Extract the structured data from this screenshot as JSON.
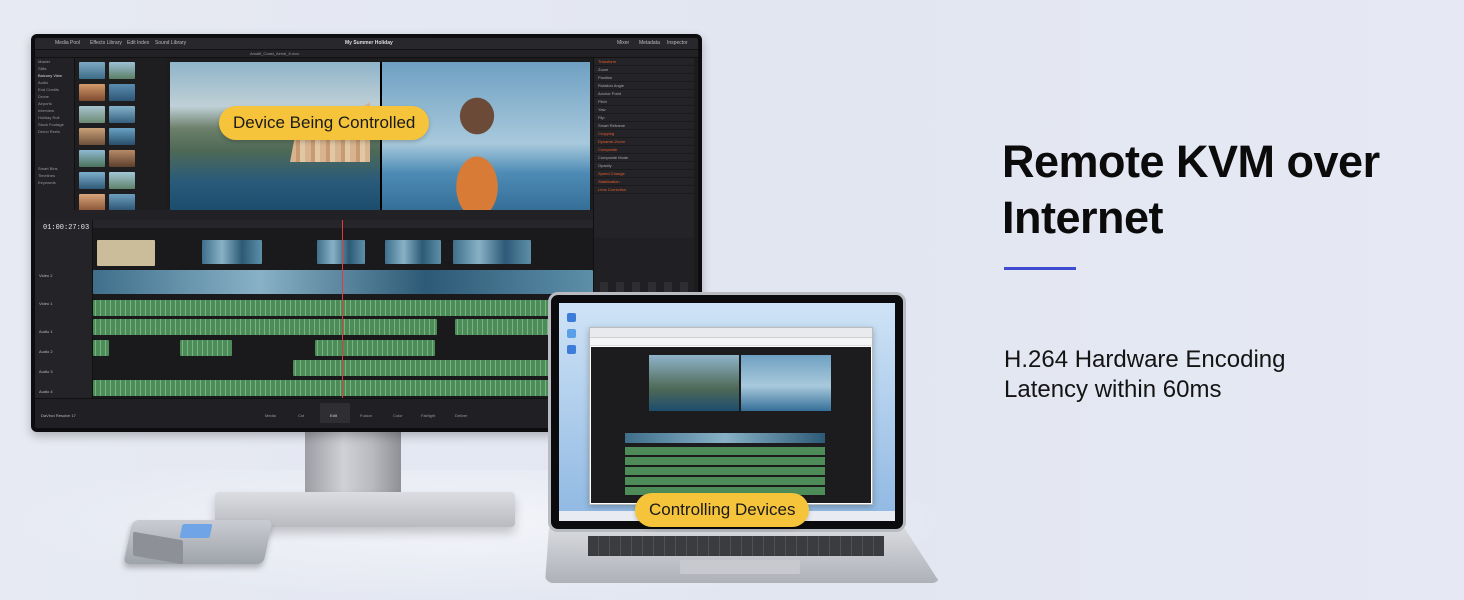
{
  "hero": {
    "headline_line1": "Remote KVM over",
    "headline_line2": "Internet",
    "features": [
      "H.264 Hardware Encoding",
      "Latency within 60ms"
    ],
    "accent_color": "#3e4bd0"
  },
  "callouts": {
    "device": "Device Being Controlled",
    "controller": "Controlling Devices",
    "color": "#f5c43b"
  },
  "resolve": {
    "project_title": "My Summer Holiday",
    "clip_name": "Amalfi_Coast_Aerial_8.mov",
    "timecode": "01:00:27:03",
    "brand": "DaVinci Resolve 17",
    "top_tabs": [
      "Media Pool",
      "Effects Library",
      "Edit Index",
      "Sound Library",
      "Mixer",
      "Metadata",
      "Inspector"
    ],
    "sidebar": [
      "Master",
      "Stills",
      "Balcony View",
      "Audio",
      "End Credits",
      "Drone",
      "Airports",
      "Interview",
      "Holiday Roll",
      "Stock Footage",
      "Demo Reels",
      "Smart Bins",
      "Timelines",
      "Keywords"
    ],
    "tracks": [
      "Video 2",
      "Video 1",
      "Audio 1",
      "Audio 2",
      "Audio 3",
      "Audio 4",
      "Audio 5"
    ],
    "inspector_rows": [
      "Transform",
      "Zoom",
      "Position",
      "Rotation Angle",
      "Anchor Point",
      "Pitch",
      "Yaw",
      "Flip",
      "Smart Reframe",
      "Cropping",
      "Dynamic Zoom",
      "Composite",
      "Composite Mode",
      "Opacity",
      "Speed Change",
      "Stabilization",
      "Lens Correction"
    ],
    "pages": [
      "Media",
      "Cut",
      "Edit",
      "Fusion",
      "Color",
      "Fairlight",
      "Deliver"
    ]
  }
}
